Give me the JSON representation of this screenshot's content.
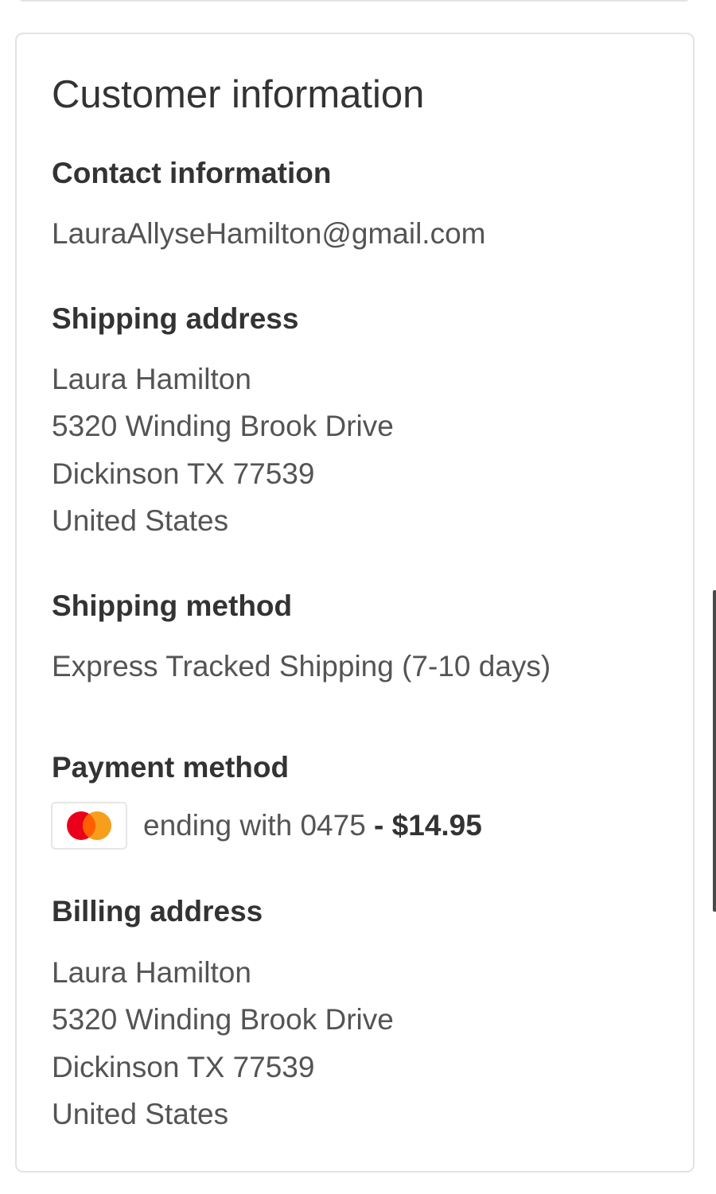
{
  "card": {
    "title": "Customer information"
  },
  "contact": {
    "heading": "Contact information",
    "email": "LauraAllyseHamilton@gmail.com"
  },
  "shipping_address": {
    "heading": "Shipping address",
    "lines": [
      "Laura Hamilton",
      "5320 Winding Brook Drive",
      "Dickinson TX 77539",
      "United States"
    ]
  },
  "shipping_method": {
    "heading": "Shipping method",
    "value": "Express Tracked Shipping (7-10 days)"
  },
  "payment_method": {
    "heading": "Payment method",
    "card_icon": "mastercard-icon",
    "ending_text": "ending with 0475",
    "separator": " - ",
    "amount": "$14.95",
    "colors": {
      "red": "#EB001B",
      "orange": "#F79E1B"
    }
  },
  "billing_address": {
    "heading": "Billing address",
    "lines": [
      "Laura Hamilton",
      "5320 Winding Brook Drive",
      "Dickinson TX 77539",
      "United States"
    ]
  }
}
